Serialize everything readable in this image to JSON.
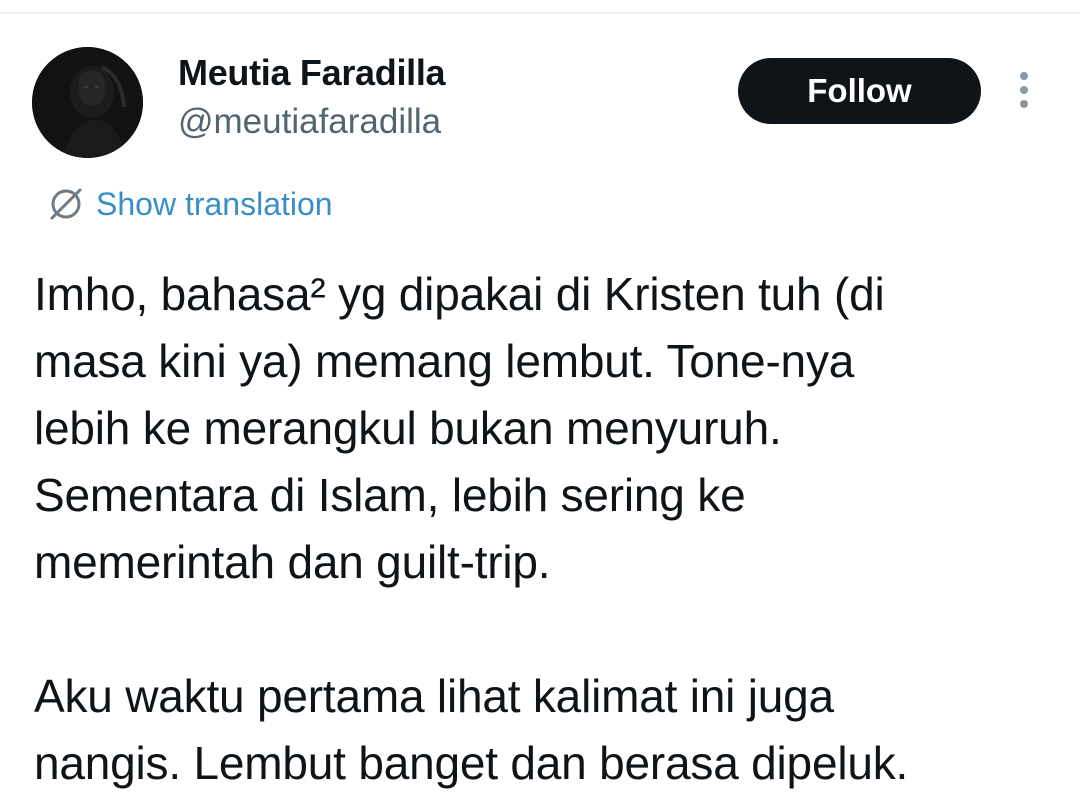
{
  "author": {
    "display_name": "Meutia Faradilla",
    "handle": "@meutiafaradilla",
    "avatar_icon": "profile-photo"
  },
  "actions": {
    "follow_label": "Follow",
    "more_icon": "more-vertical-icon"
  },
  "translation": {
    "icon": "globe-slash-icon",
    "label": "Show translation"
  },
  "tweet": {
    "paragraphs": [
      {
        "lines": [
          "Imho, bahasa² yg dipakai di Kristen tuh (di",
          "masa kini ya) memang lembut. Tone-nya",
          "lebih ke merangkul bukan menyuruh.",
          "Sementara di Islam, lebih sering ke",
          "memerintah dan guilt-trip."
        ]
      },
      {
        "lines": [
          "Aku waktu pertama lihat kalimat ini juga",
          "nangis. Lembut banget dan berasa dipeluk."
        ]
      }
    ]
  },
  "colors": {
    "follow_bg": "#0f1419",
    "link": "#3a8ec7",
    "secondary_text": "#536471"
  }
}
